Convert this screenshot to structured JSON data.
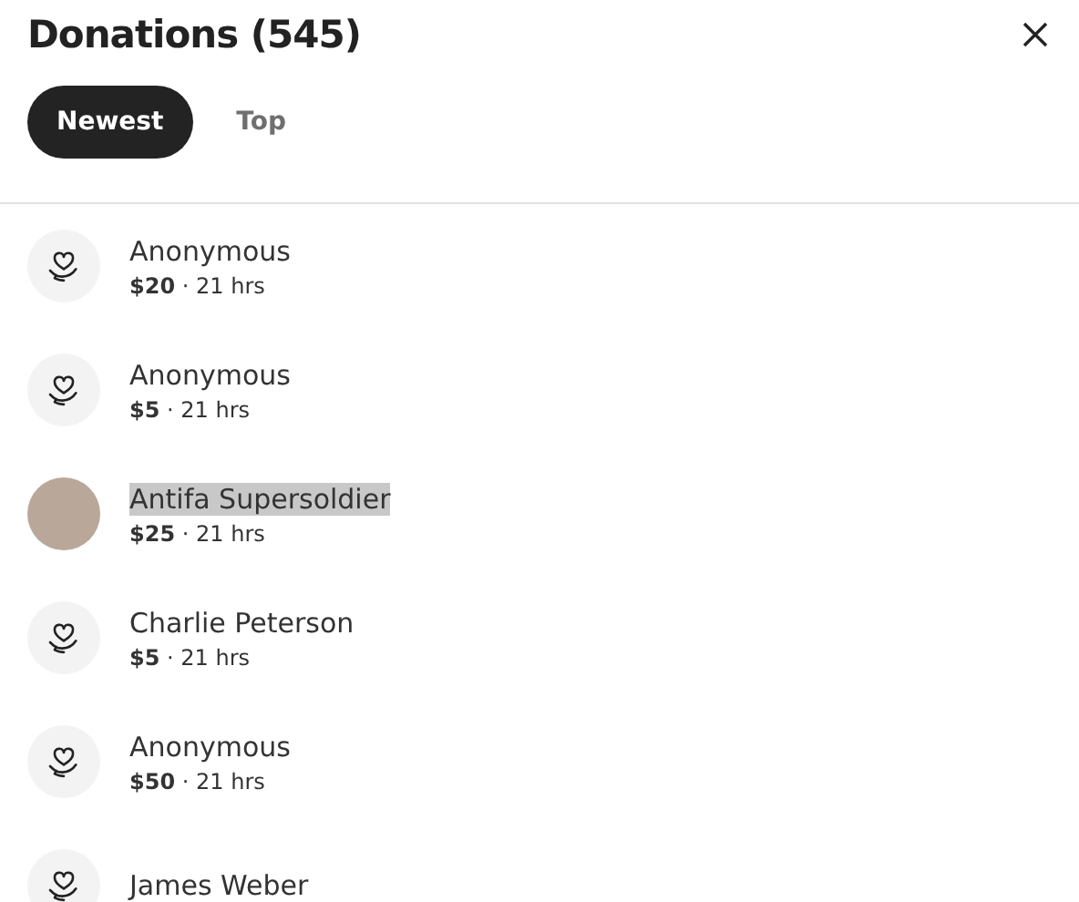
{
  "title": "Donations (545)",
  "tabs": [
    {
      "label": "Newest",
      "selected": true
    },
    {
      "label": "Top",
      "selected": false
    }
  ],
  "donations": [
    {
      "kind": "anonymous",
      "name": "Anonymous",
      "highlighted": false,
      "detail": "**$20** · 21 hrs"
    },
    {
      "kind": "anonymous",
      "name": "Anonymous",
      "highlighted": false,
      "detail": "**$5** · 21 hrs"
    },
    {
      "kind": "photo",
      "name": "Antifa Supersoldier",
      "highlighted": true,
      "detail": "**$25** · 21 hrs"
    },
    {
      "kind": "anonymous",
      "name": "Charlie Peterson",
      "highlighted": false,
      "detail": "**$5** · 21 hrs"
    },
    {
      "kind": "anonymous",
      "name": "Anonymous",
      "highlighted": false,
      "detail": "**$50** · 21 hrs"
    },
    {
      "kind": "anonymous",
      "name": "James Weber",
      "highlighted": false
    }
  ]
}
